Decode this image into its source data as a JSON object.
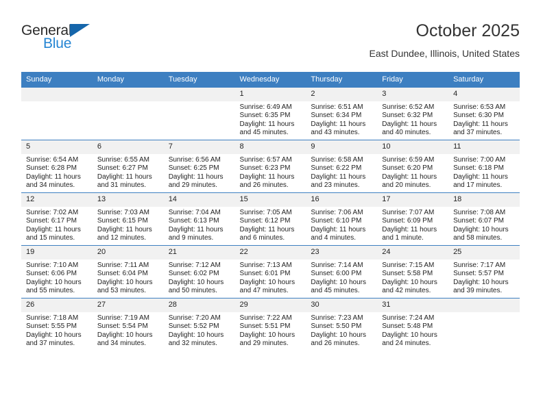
{
  "brand": {
    "line1": "General",
    "line2": "Blue",
    "triangle_icon": "triangle-icon",
    "color_dark": "#2b2b2b",
    "color_blue": "#2585d3",
    "accent": "#1566ab"
  },
  "header": {
    "title": "October 2025",
    "subtitle": "East Dundee, Illinois, United States"
  },
  "theme": {
    "header_blue": "#3d7fc1",
    "daynum_gray": "#f1f1f1",
    "text": "#222222"
  },
  "weekday_headers": [
    "Sunday",
    "Monday",
    "Tuesday",
    "Wednesday",
    "Thursday",
    "Friday",
    "Saturday"
  ],
  "labels": {
    "sunrise": "Sunrise:",
    "sunset": "Sunset:",
    "daylight": "Daylight:"
  },
  "weeks": [
    [
      {
        "day": "",
        "lines": []
      },
      {
        "day": "",
        "lines": []
      },
      {
        "day": "",
        "lines": []
      },
      {
        "day": "1",
        "lines": [
          "Sunrise: 6:49 AM",
          "Sunset: 6:35 PM",
          "Daylight: 11 hours and 45 minutes."
        ]
      },
      {
        "day": "2",
        "lines": [
          "Sunrise: 6:51 AM",
          "Sunset: 6:34 PM",
          "Daylight: 11 hours and 43 minutes."
        ]
      },
      {
        "day": "3",
        "lines": [
          "Sunrise: 6:52 AM",
          "Sunset: 6:32 PM",
          "Daylight: 11 hours and 40 minutes."
        ]
      },
      {
        "day": "4",
        "lines": [
          "Sunrise: 6:53 AM",
          "Sunset: 6:30 PM",
          "Daylight: 11 hours and 37 minutes."
        ]
      }
    ],
    [
      {
        "day": "5",
        "lines": [
          "Sunrise: 6:54 AM",
          "Sunset: 6:28 PM",
          "Daylight: 11 hours and 34 minutes."
        ]
      },
      {
        "day": "6",
        "lines": [
          "Sunrise: 6:55 AM",
          "Sunset: 6:27 PM",
          "Daylight: 11 hours and 31 minutes."
        ]
      },
      {
        "day": "7",
        "lines": [
          "Sunrise: 6:56 AM",
          "Sunset: 6:25 PM",
          "Daylight: 11 hours and 29 minutes."
        ]
      },
      {
        "day": "8",
        "lines": [
          "Sunrise: 6:57 AM",
          "Sunset: 6:23 PM",
          "Daylight: 11 hours and 26 minutes."
        ]
      },
      {
        "day": "9",
        "lines": [
          "Sunrise: 6:58 AM",
          "Sunset: 6:22 PM",
          "Daylight: 11 hours and 23 minutes."
        ]
      },
      {
        "day": "10",
        "lines": [
          "Sunrise: 6:59 AM",
          "Sunset: 6:20 PM",
          "Daylight: 11 hours and 20 minutes."
        ]
      },
      {
        "day": "11",
        "lines": [
          "Sunrise: 7:00 AM",
          "Sunset: 6:18 PM",
          "Daylight: 11 hours and 17 minutes."
        ]
      }
    ],
    [
      {
        "day": "12",
        "lines": [
          "Sunrise: 7:02 AM",
          "Sunset: 6:17 PM",
          "Daylight: 11 hours and 15 minutes."
        ]
      },
      {
        "day": "13",
        "lines": [
          "Sunrise: 7:03 AM",
          "Sunset: 6:15 PM",
          "Daylight: 11 hours and 12 minutes."
        ]
      },
      {
        "day": "14",
        "lines": [
          "Sunrise: 7:04 AM",
          "Sunset: 6:13 PM",
          "Daylight: 11 hours and 9 minutes."
        ]
      },
      {
        "day": "15",
        "lines": [
          "Sunrise: 7:05 AM",
          "Sunset: 6:12 PM",
          "Daylight: 11 hours and 6 minutes."
        ]
      },
      {
        "day": "16",
        "lines": [
          "Sunrise: 7:06 AM",
          "Sunset: 6:10 PM",
          "Daylight: 11 hours and 4 minutes."
        ]
      },
      {
        "day": "17",
        "lines": [
          "Sunrise: 7:07 AM",
          "Sunset: 6:09 PM",
          "Daylight: 11 hours and 1 minute."
        ]
      },
      {
        "day": "18",
        "lines": [
          "Sunrise: 7:08 AM",
          "Sunset: 6:07 PM",
          "Daylight: 10 hours and 58 minutes."
        ]
      }
    ],
    [
      {
        "day": "19",
        "lines": [
          "Sunrise: 7:10 AM",
          "Sunset: 6:06 PM",
          "Daylight: 10 hours and 55 minutes."
        ]
      },
      {
        "day": "20",
        "lines": [
          "Sunrise: 7:11 AM",
          "Sunset: 6:04 PM",
          "Daylight: 10 hours and 53 minutes."
        ]
      },
      {
        "day": "21",
        "lines": [
          "Sunrise: 7:12 AM",
          "Sunset: 6:02 PM",
          "Daylight: 10 hours and 50 minutes."
        ]
      },
      {
        "day": "22",
        "lines": [
          "Sunrise: 7:13 AM",
          "Sunset: 6:01 PM",
          "Daylight: 10 hours and 47 minutes."
        ]
      },
      {
        "day": "23",
        "lines": [
          "Sunrise: 7:14 AM",
          "Sunset: 6:00 PM",
          "Daylight: 10 hours and 45 minutes."
        ]
      },
      {
        "day": "24",
        "lines": [
          "Sunrise: 7:15 AM",
          "Sunset: 5:58 PM",
          "Daylight: 10 hours and 42 minutes."
        ]
      },
      {
        "day": "25",
        "lines": [
          "Sunrise: 7:17 AM",
          "Sunset: 5:57 PM",
          "Daylight: 10 hours and 39 minutes."
        ]
      }
    ],
    [
      {
        "day": "26",
        "lines": [
          "Sunrise: 7:18 AM",
          "Sunset: 5:55 PM",
          "Daylight: 10 hours and 37 minutes."
        ]
      },
      {
        "day": "27",
        "lines": [
          "Sunrise: 7:19 AM",
          "Sunset: 5:54 PM",
          "Daylight: 10 hours and 34 minutes."
        ]
      },
      {
        "day": "28",
        "lines": [
          "Sunrise: 7:20 AM",
          "Sunset: 5:52 PM",
          "Daylight: 10 hours and 32 minutes."
        ]
      },
      {
        "day": "29",
        "lines": [
          "Sunrise: 7:22 AM",
          "Sunset: 5:51 PM",
          "Daylight: 10 hours and 29 minutes."
        ]
      },
      {
        "day": "30",
        "lines": [
          "Sunrise: 7:23 AM",
          "Sunset: 5:50 PM",
          "Daylight: 10 hours and 26 minutes."
        ]
      },
      {
        "day": "31",
        "lines": [
          "Sunrise: 7:24 AM",
          "Sunset: 5:48 PM",
          "Daylight: 10 hours and 24 minutes."
        ]
      },
      {
        "day": "",
        "lines": []
      }
    ]
  ]
}
